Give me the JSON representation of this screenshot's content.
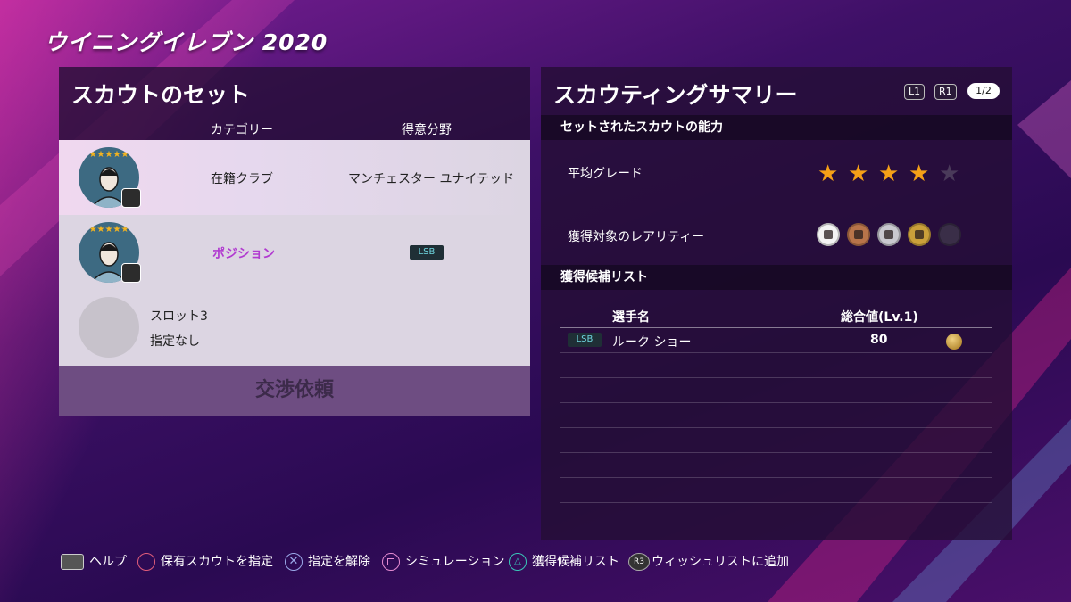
{
  "app": {
    "title": "ウイニングイレブン 2020"
  },
  "scout_set": {
    "title": "スカウトのセット",
    "columns": [
      "カテゴリー",
      "得意分野"
    ],
    "rows": [
      {
        "category": "在籍クラブ",
        "specialty": "マンチェスター ユナイテッド",
        "stars": "★★★★★"
      },
      {
        "category": "ポジション",
        "specialty": "LSB",
        "stars": "★★★★★"
      }
    ],
    "empty_slot": {
      "label": "スロット3",
      "status": "指定なし"
    },
    "negotiate_button": "交渉依頼"
  },
  "summary": {
    "title": "スカウティングサマリー",
    "l1": "L1",
    "r1": "R1",
    "page": "1/2",
    "ability_section": "セットされたスカウトの能力",
    "avg_grade_label": "平均グレード",
    "avg_grade": 4,
    "avg_grade_max": 5,
    "rarity_label": "獲得対象のレアリティー",
    "rarities": [
      "white",
      "bronze",
      "silver",
      "gold",
      "empty"
    ],
    "rarity_colors": {
      "white": "#f4f4f4",
      "bronze": "#b8744a",
      "silver": "#c9c9cf",
      "gold": "#caa03a",
      "empty": "#3a2e48"
    },
    "candidates_section": "獲得候補リスト",
    "list_columns": [
      "選手名",
      "総合値(Lv.1)"
    ],
    "candidates": [
      {
        "pos": "LSB",
        "name": "ルーク ショー",
        "overall": "80",
        "rarity": "gold"
      }
    ]
  },
  "footer": [
    {
      "icon": "touchpad-icon",
      "label": "ヘルプ"
    },
    {
      "icon": "circle-button-icon",
      "label": "保有スカウトを指定"
    },
    {
      "icon": "cross-button-icon",
      "label": "指定を解除"
    },
    {
      "icon": "square-button-icon",
      "label": "シミュレーション"
    },
    {
      "icon": "triangle-button-icon",
      "label": "獲得候補リスト"
    },
    {
      "icon": "r3-button-icon",
      "label": "ウィッシュリストに追加"
    }
  ]
}
